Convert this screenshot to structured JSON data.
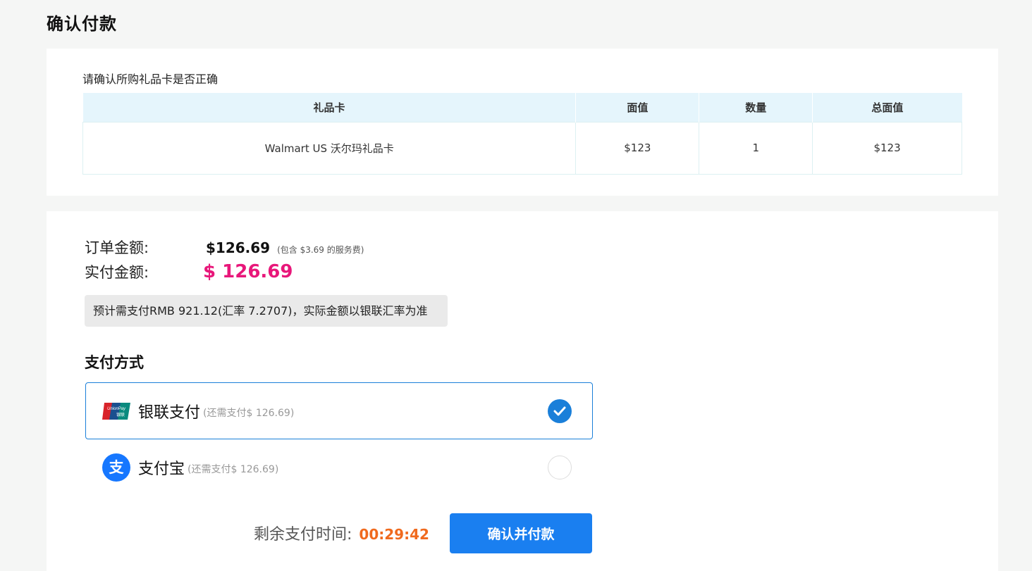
{
  "page": {
    "title": "确认付款"
  },
  "giftcards": {
    "hint": "请确认所购礼品卡是否正确",
    "headers": [
      "礼品卡",
      "面值",
      "数量",
      "总面值"
    ],
    "rows": [
      [
        "Walmart US 沃尔玛礼品卡",
        "$123",
        "1",
        "$123"
      ]
    ]
  },
  "order": {
    "order_label": "订单金额:",
    "order_value": "$126.69",
    "fee_note": "(包含 $3.69 的服务费)",
    "paid_label": "实付金额:",
    "paid_value": "$ 126.69",
    "rmb_note": "预计需支付RMB 921.12(汇率 7.2707)，实际金额以银联汇率为准"
  },
  "payment": {
    "title": "支付方式",
    "methods": [
      {
        "name": "银联支付",
        "remain": "(还需支付$ 126.69)",
        "icon": "unionpay-icon",
        "selected": true
      },
      {
        "name": "支付宝",
        "remain": "(还需支付$ 126.69)",
        "icon": "alipay-icon",
        "selected": false
      }
    ]
  },
  "footer": {
    "timer_label": "剩余支付时间:",
    "timer_value": "00:29:42",
    "pay_button": "确认并付款"
  },
  "colors": {
    "accent_blue": "#1a7ff0",
    "price_pink": "#e8177a",
    "timer_orange": "#f06a1e"
  }
}
